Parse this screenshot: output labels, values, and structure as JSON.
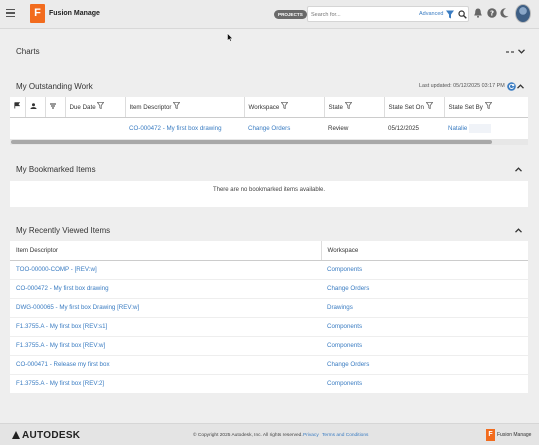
{
  "app": {
    "logo_letter": "F",
    "title": "Fusion Manage",
    "projects_label": "PROJECTS",
    "search_placeholder": "Search for...",
    "advanced_label": "Advanced"
  },
  "charts": {
    "title": "Charts"
  },
  "outstanding": {
    "title": "My Outstanding Work",
    "last_updated": "Last updated: 05/12/2025 03:17 PM",
    "columns": [
      "Due Date",
      "Item Descriptor",
      "Workspace",
      "State",
      "State Set On",
      "State Set By"
    ],
    "rows": [
      {
        "due": "",
        "item": "CO-000472 - My first box drawing",
        "workspace": "Change Orders",
        "state": "Review",
        "set_on": "05/12/2025",
        "set_by": "Natalie"
      }
    ]
  },
  "bookmarked": {
    "title": "My Bookmarked Items",
    "empty": "There are no bookmarked items available."
  },
  "recent": {
    "title": "My Recently Viewed Items",
    "columns": [
      "Item Descriptor",
      "Workspace"
    ],
    "rows": [
      {
        "item": "TOO-00000-COMP - [REV:w]",
        "workspace": "Components"
      },
      {
        "item": "CO-000472 - My first box drawing",
        "workspace": "Change Orders"
      },
      {
        "item": "DWG-000065 - My first box Drawing [REV:w]",
        "workspace": "Drawings"
      },
      {
        "item": "F1.3755.A - My first box [REV:s1]",
        "workspace": "Components"
      },
      {
        "item": "F1.3755.A - My first box [REV:w]",
        "workspace": "Components"
      },
      {
        "item": "CO-000471 - Release my first box",
        "workspace": "Change Orders"
      },
      {
        "item": "F1.3755.A - My first box [REV:2]",
        "workspace": "Components"
      }
    ]
  },
  "footer": {
    "brand": "AUTODESK",
    "copyright": "© Copyright 2025 Autodesk, Inc. All rights reserved.",
    "privacy": "Privacy",
    "terms": "Terms and Conditions",
    "product_letter": "F",
    "product": "Fusion Manage"
  },
  "colors": {
    "accent": "#3a7cc2",
    "brand": "#f26b1d"
  }
}
